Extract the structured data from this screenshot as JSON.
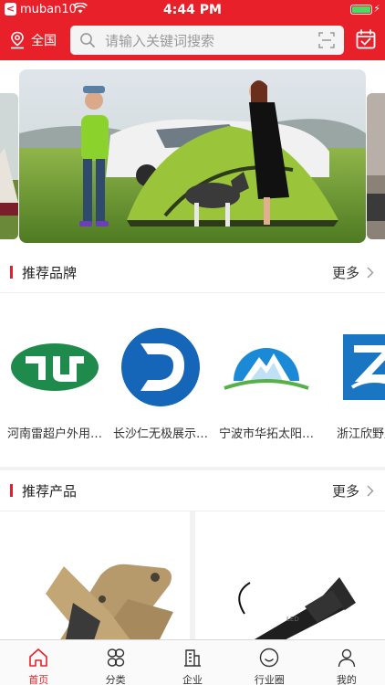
{
  "status_bar": {
    "carrier": "muban10",
    "time": "4:44 PM"
  },
  "header": {
    "location_label": "全国",
    "search_placeholder": "请输入关键词搜索"
  },
  "banner": {
    "image_desc": "camping tent on grass"
  },
  "recommended_brands": {
    "title": "推荐品牌",
    "more_label": "更多",
    "items": [
      {
        "name": "河南雷超户外用…"
      },
      {
        "name": "长沙仁无极展示…"
      },
      {
        "name": "宁波市华拓太阳…"
      },
      {
        "name": "浙江欣野户外"
      }
    ]
  },
  "recommended_products": {
    "title": "推荐产品",
    "more_label": "更多"
  },
  "tabbar": {
    "items": [
      {
        "label": "首页",
        "icon": "home-icon",
        "active": true
      },
      {
        "label": "分类",
        "icon": "category-icon",
        "active": false
      },
      {
        "label": "企业",
        "icon": "building-icon",
        "active": false
      },
      {
        "label": "行业圈",
        "icon": "smile-icon",
        "active": false
      },
      {
        "label": "我的",
        "icon": "user-icon",
        "active": false
      }
    ]
  },
  "colors": {
    "accent": "#e8202a",
    "background": "#f2f2f2"
  }
}
